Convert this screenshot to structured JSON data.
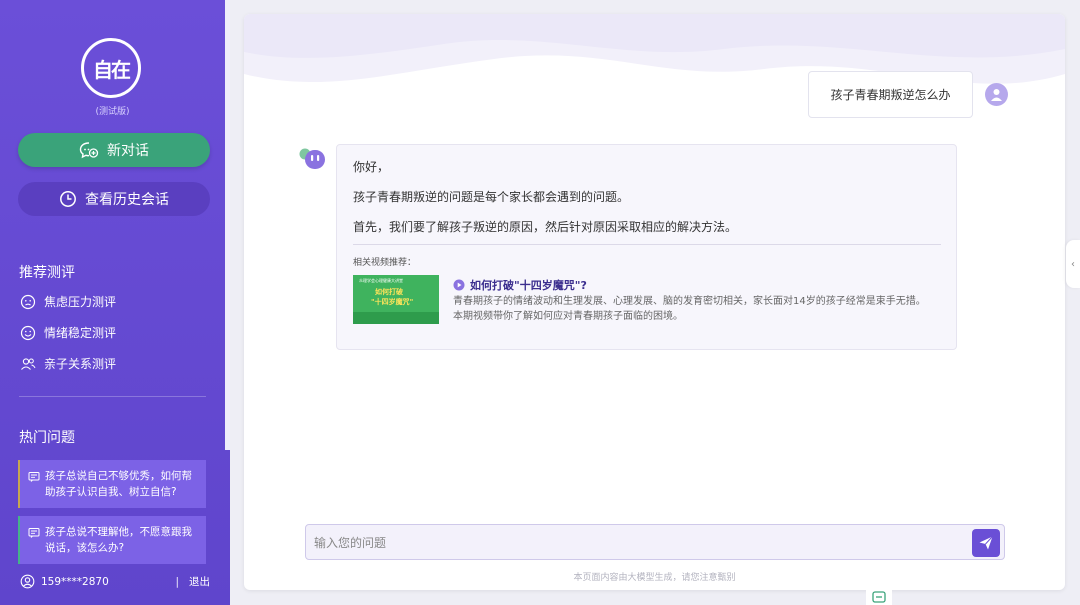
{
  "sidebar": {
    "logo_text": "自在",
    "beta_label": "(测试版)",
    "new_chat_label": "新对话",
    "history_label": "查看历史会话",
    "eval_title": "推荐测评",
    "evals": [
      {
        "label": "焦虑压力测评",
        "icon": "face-icon"
      },
      {
        "label": "情绪稳定测评",
        "icon": "smile-icon"
      },
      {
        "label": "亲子关系测评",
        "icon": "users-icon"
      }
    ],
    "hot_title": "热门问题",
    "hot_questions": [
      {
        "text": "孩子总说自己不够优秀，如何帮助孩子认识自我、树立自信?"
      },
      {
        "text": "孩子总说不理解他，不愿意跟我说话，该怎么办?"
      }
    ],
    "user_phone": "159****2870",
    "separator": "|",
    "logout_label": "退出"
  },
  "chat": {
    "user_message": "孩子青春期叛逆怎么办",
    "bot_lines": [
      "你好，",
      "孩子青春期叛逆的问题是每个家长都会遇到的问题。",
      "首先，我们要了解孩子叛逆的原因，然后针对原因采取相应的解决方法。"
    ],
    "related_label": "相关视频推荐：",
    "video": {
      "thumb_header": "众理学会心理健康大讲堂",
      "thumb_line1": "如何打破",
      "thumb_line2": "\"十四岁魔咒\"",
      "title": "如何打破\"十四岁魔咒\"?",
      "description": "青春期孩子的情绪波动和生理发展、心理发展、脑的发育密切相关，家长面对14岁的孩子经常是束手无措。本期视频带你了解如何应对青春期孩子面临的困境。"
    }
  },
  "input": {
    "placeholder": "输入您的问题",
    "value": ""
  },
  "disclaimer": "本页面内容由大模型生成，请您注意甄别",
  "colors": {
    "sidebar": "#6b4fd8",
    "new_chat": "#3aa37a",
    "accent": "#6a4fd6"
  }
}
